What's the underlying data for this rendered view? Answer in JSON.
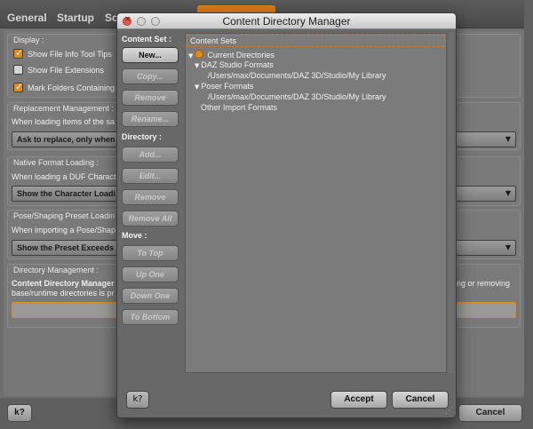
{
  "background": {
    "tabs": [
      "General",
      "Startup",
      "Sc"
    ],
    "groups": {
      "display": {
        "title": "Display :",
        "options": [
          {
            "label": "Show File Info Tool Tips",
            "checked": true
          },
          {
            "label": "Show File Extensions",
            "checked": false
          },
          {
            "label": "Mark Folders Containing",
            "checked": true
          }
        ]
      },
      "replacement": {
        "title": "Replacement Management :",
        "text": "When loading items of the sa",
        "combo": "Ask to replace, only when"
      },
      "native": {
        "title": "Native Format Loading :",
        "text": "When loading a DUF Characte",
        "combo": "Show the Character Loadi"
      },
      "pose": {
        "title": "Pose/Shaping Preset Loadin",
        "text": "When importing a Pose/Shap",
        "combo": "Show the Preset Exceeds"
      },
      "directory": {
        "title": "Directory Management :",
        "text1_bold": "Content Directory Manager",
        "text1_right": "ding or removing",
        "text2": "base/runtime directories is pr"
      }
    },
    "help_label": "k?",
    "cancel_label": "Cancel"
  },
  "dialog": {
    "title": "Content Directory Manager",
    "content_set_label": "Content Set :",
    "content_set_buttons": [
      {
        "label": "New...",
        "enabled": true
      },
      {
        "label": "Copy...",
        "enabled": false
      },
      {
        "label": "Remove",
        "enabled": false
      },
      {
        "label": "Rename...",
        "enabled": false
      }
    ],
    "directory_label": "Directory :",
    "directory_buttons": [
      {
        "label": "Add...",
        "enabled": false
      },
      {
        "label": "Edit...",
        "enabled": false
      },
      {
        "label": "Remove",
        "enabled": false
      },
      {
        "label": "Remove All",
        "enabled": false
      }
    ],
    "move_label": "Move :",
    "move_buttons": [
      {
        "label": "To Top",
        "enabled": false
      },
      {
        "label": "Up One",
        "enabled": false
      },
      {
        "label": "Down One",
        "enabled": false
      },
      {
        "label": "To Bottom",
        "enabled": false
      }
    ],
    "tree": {
      "header": "Content Sets",
      "current": "Current Directories",
      "daz_formats": "DAZ Studio Formats",
      "daz_path": "/Users/max/Documents/DAZ 3D/Studio/My Library",
      "poser_formats": "Poser Formats",
      "poser_path": "/Users/max/Documents/DAZ 3D/Studio/My Library",
      "other": "Other Import Formats"
    },
    "help_label": "k?",
    "accept_label": "Accept",
    "cancel_label": "Cancel"
  },
  "colors": {
    "accent": "#e08a1e",
    "panel": "#686868"
  }
}
